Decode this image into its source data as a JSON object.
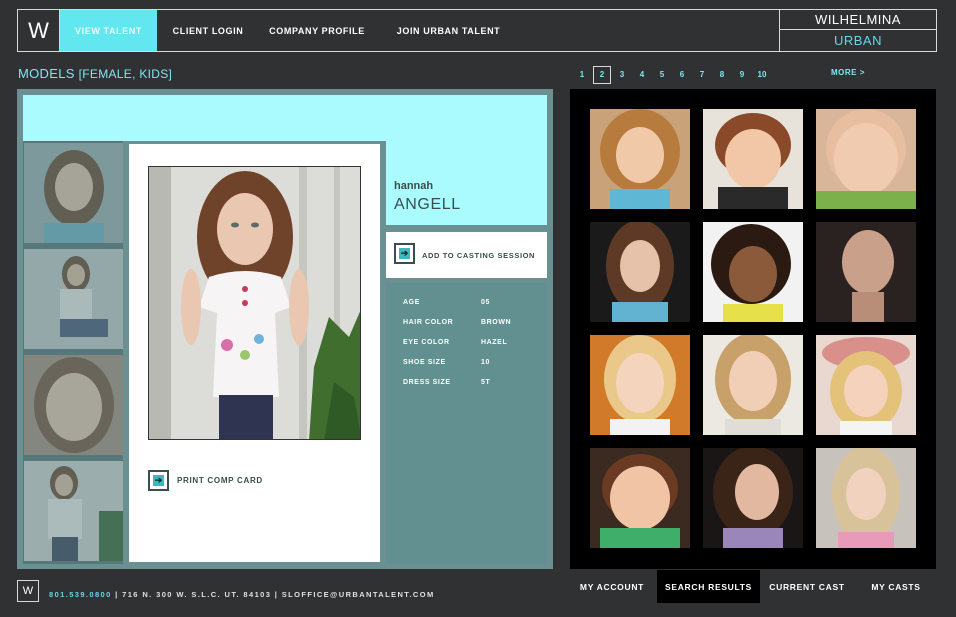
{
  "nav": {
    "logo": "W",
    "items": [
      {
        "label": "VIEW TALENT",
        "active": true
      },
      {
        "label": "CLIENT LOGIN",
        "active": false
      },
      {
        "label": "COMPANY PROFILE",
        "active": false
      },
      {
        "label": "JOIN URBAN TALENT",
        "active": false
      }
    ],
    "brand_top": "WILHELMINA",
    "brand_bottom": "URBAN"
  },
  "heading": {
    "title": "MODELS",
    "subtitle": "[FEMALE, KIDS]"
  },
  "pagination": {
    "pages": [
      "1",
      "2",
      "3",
      "4",
      "5",
      "6",
      "7",
      "8",
      "9",
      "10"
    ],
    "current": "2",
    "more": "MORE >"
  },
  "profile": {
    "first_name": "hannah",
    "last_name": "ANGELL",
    "add_to_casting": "ADD TO CASTING SESSION",
    "print_comp_card": "PRINT COMP CARD",
    "stats": [
      {
        "label": "AGE",
        "value": "05"
      },
      {
        "label": "HAIR COLOR",
        "value": "BROWN"
      },
      {
        "label": "EYE COLOR",
        "value": "HAZEL"
      },
      {
        "label": "SHOE SIZE",
        "value": "10"
      },
      {
        "label": "DRESS SIZE",
        "value": "5T"
      }
    ]
  },
  "colors": {
    "accent": "#62e6ef",
    "panel": "#6a9091",
    "light": "#a9fbfd"
  },
  "footer": {
    "logo": "W",
    "phone": "801.539.0800",
    "info": " | 716 N. 300 W. S.L.C. UT. 84103 | SLOFFICE@URBANTALENT.COM",
    "tabs": [
      {
        "label": "MY ACCOUNT",
        "active": false
      },
      {
        "label": "SEARCH RESULTS",
        "active": true
      },
      {
        "label": "CURRENT CAST",
        "active": false
      },
      {
        "label": "MY CASTS",
        "active": false
      }
    ]
  }
}
